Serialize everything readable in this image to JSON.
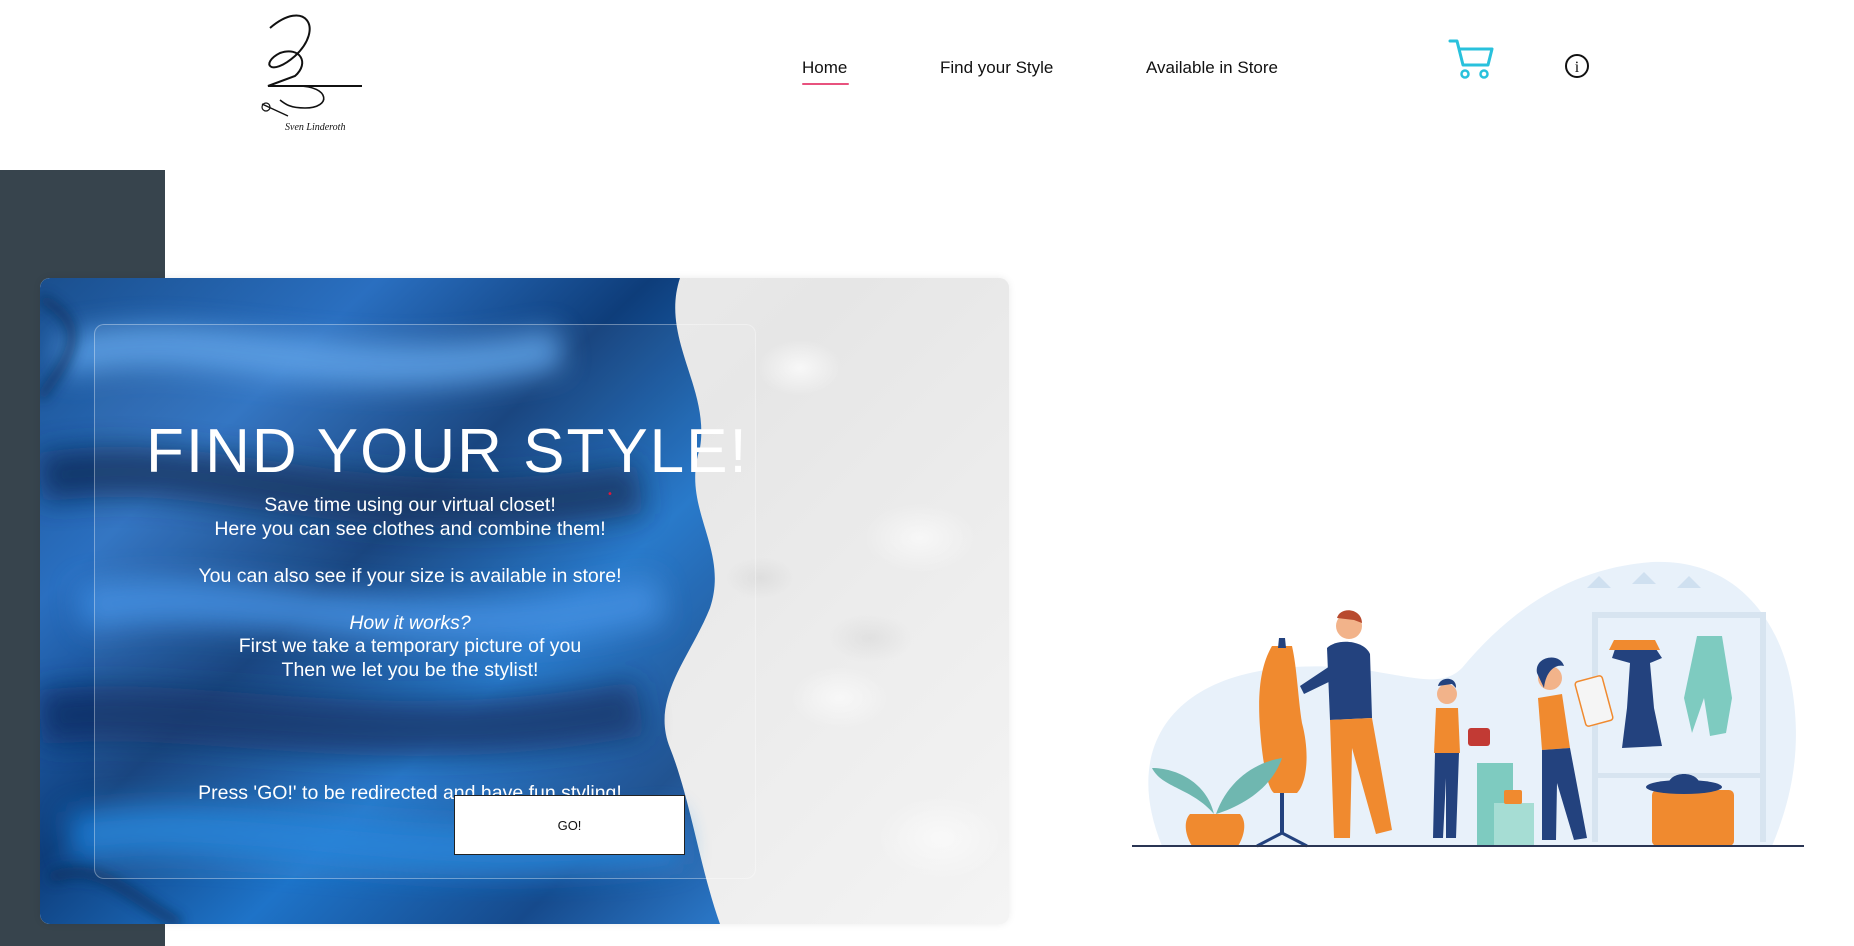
{
  "header": {
    "logo_text": "Sven Linderoth",
    "nav": [
      {
        "label": "Home"
      },
      {
        "label": "Find your Style"
      },
      {
        "label": "Available in Store"
      }
    ],
    "cart_icon": "shopping-cart-icon",
    "info_icon": "info-icon",
    "info_glyph": "i"
  },
  "hero": {
    "title": "FIND YOUR STYLE!",
    "lines": [
      "Save time using our virtual closet!",
      "Here you can see clothes and combine them!",
      "",
      "You can also see if your size is available in store!",
      "",
      "How it works?",
      "First we take a temporary picture of you",
      "Then we let you be the stylist!"
    ],
    "cta_text": "Press 'GO!' to be redirected and have fun styling!",
    "go_label": "GO!"
  },
  "colors": {
    "accent_underline": "#e8527e",
    "cart": "#29c1dc",
    "slate": "#37444d",
    "fabric_blue": "#1a5fb4"
  }
}
